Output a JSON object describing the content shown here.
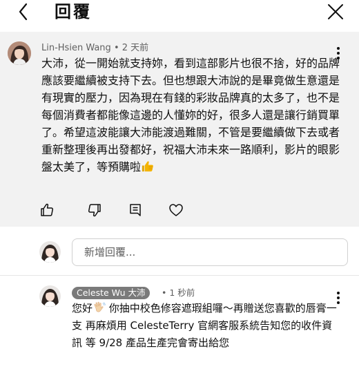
{
  "header": {
    "title": "回覆",
    "back_icon": "back-chevron-icon",
    "close_icon": "close-icon"
  },
  "parent_comment": {
    "author": "Lin-Hsien Wang",
    "separator": "•",
    "time": "2 天前",
    "text": "大沛，從一開始就支持妳，看到這部影片也很不捨，好的品牌應該要繼續被支持下去。但也想跟大沛說的是畢竟做生意還是有現實的壓力，因為現在有錢的彩妝品牌真的太多了，也不是每個消費者都能像這邊的人懂妳的好，很多人還是讓行銷買單了。希望這波能讓大沛能渡過難關，不管是要繼續做下去或者重新整理後再出發都好，祝福大沛未來一路順利，影片的眼影盤太美了，等預購啦",
    "emoji_icon": "thumbs-up-emoji-icon",
    "actions": [
      "like-icon",
      "dislike-icon",
      "reply-icon",
      "heart-icon"
    ]
  },
  "reply_box": {
    "placeholder": "新增回覆..."
  },
  "reply": {
    "author": "Celeste Wu 大沛",
    "separator": "•",
    "time": "1 秒前",
    "greeting": "您好",
    "wave_icon": "waving-hand-emoji-icon",
    "text": " 你抽中校色修容遮瑕組囉～再贈送您喜歡的唇膏一支 再麻煩用 CelesteTerry 官網客服系統告知您的收件資訊 等 9/28 產品生產完會寄出給您"
  },
  "colors": {
    "parent_background": "#f2f2f2",
    "badge_background": "#7a7a7a",
    "meta_text": "#606060",
    "emoji_yellow": "#f4b400"
  }
}
